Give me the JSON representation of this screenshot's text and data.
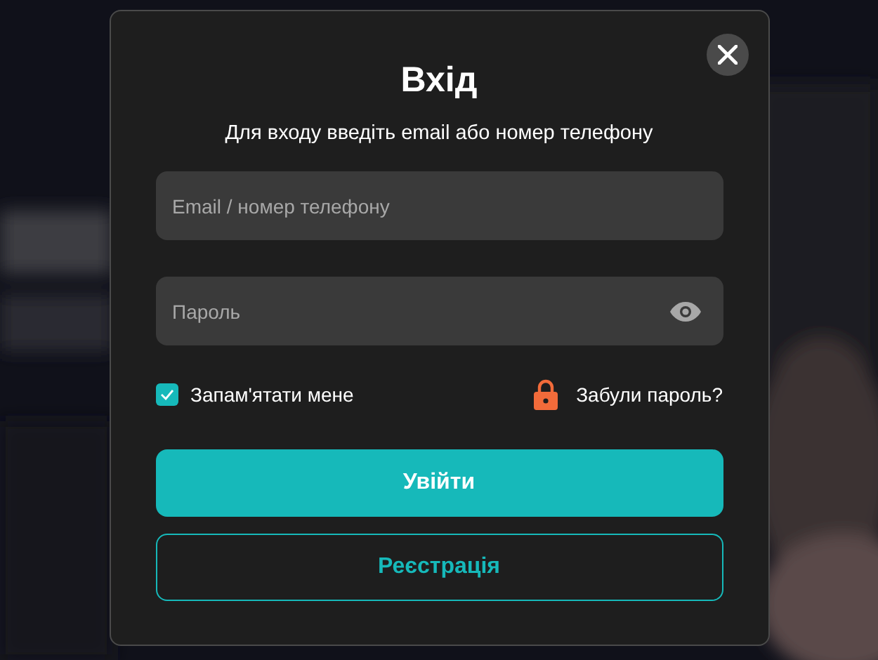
{
  "dialog": {
    "title": "Вхід",
    "subtitle": "Для входу введіть email або номер телефону",
    "login_field": {
      "placeholder": "Email / номер телефону"
    },
    "password_field": {
      "placeholder": "Пароль"
    },
    "remember": {
      "label": "Запам'ятати мене",
      "checked": true
    },
    "forgot_link": "Забули пароль?",
    "buttons": [
      {
        "label": "Увійти",
        "kind": "primary"
      },
      {
        "label": "Реєстрація",
        "kind": "outline"
      }
    ]
  }
}
